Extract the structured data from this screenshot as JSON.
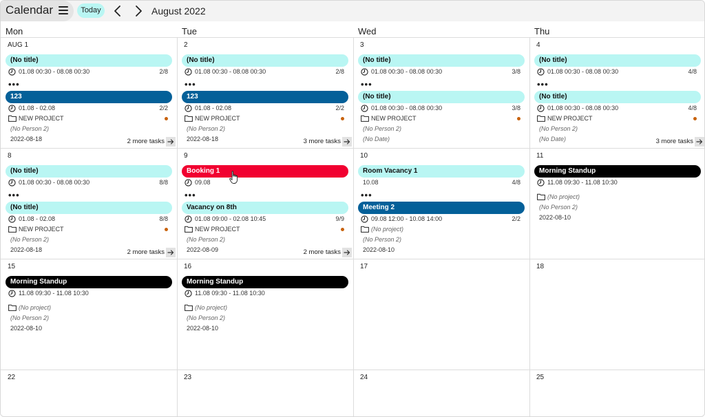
{
  "header": {
    "app_title": "Calendar",
    "today_label": "Today",
    "month_label": "August 2022",
    "menu_icon": "hamburger-menu-icon",
    "prev_icon": "chevron-left-icon",
    "next_icon": "chevron-right-icon"
  },
  "weekdays": [
    "Mon",
    "Tue",
    "Wed",
    "Thu"
  ],
  "colors": {
    "cyan": "#b9f6f3",
    "blue": "#046099",
    "red": "#f10030",
    "black": "#000000",
    "dot": "#c8620c"
  },
  "weeks": [
    {
      "days": [
        {
          "label": "AUG 1",
          "more": "2 more tasks",
          "events": [
            {
              "title": "(No title)",
              "color": "cyan",
              "time": "01.08 00:30 - 08.08 00:30",
              "ratio": "2/8"
            },
            {
              "ellipsis": "•••"
            },
            {
              "title": "123",
              "color": "blue",
              "time": "01.08 - 02.08",
              "ratio": "2/2",
              "project": "NEW PROJECT",
              "dot": true,
              "person": "(No Person 2)",
              "date": "2022-08-18"
            }
          ]
        },
        {
          "label": "2",
          "more": "3 more tasks",
          "events": [
            {
              "title": "(No title)",
              "color": "cyan",
              "time": "01.08 00:30 - 08.08 00:30",
              "ratio": "2/8"
            },
            {
              "ellipsis": "•••"
            },
            {
              "title": "123",
              "color": "blue",
              "time": "01.08 - 02.08",
              "ratio": "2/2",
              "project": "NEW PROJECT",
              "dot": true,
              "person": "(No Person 2)",
              "date": "2022-08-18"
            }
          ]
        },
        {
          "label": "3",
          "events": [
            {
              "title": "(No title)",
              "color": "cyan",
              "time": "01.08 00:30 - 08.08 00:30",
              "ratio": "3/8"
            },
            {
              "ellipsis": "•••"
            },
            {
              "title": "(No title)",
              "color": "cyan",
              "time": "01.08 00:30 - 08.08 00:30",
              "ratio": "3/8",
              "project": "NEW PROJECT",
              "dot": true,
              "person": "(No Person 2)",
              "date": "(No Date)",
              "dateItalic": true
            }
          ]
        },
        {
          "label": "4",
          "more": "3 more tasks",
          "events": [
            {
              "title": "(No title)",
              "color": "cyan",
              "time": "01.08 00:30 - 08.08 00:30",
              "ratio": "4/8"
            },
            {
              "ellipsis": "•••"
            },
            {
              "title": "(No title)",
              "color": "cyan",
              "time": "01.08 00:30 - 08.08 00:30",
              "ratio": "4/8",
              "project": "NEW PROJECT",
              "dot": true,
              "person": "(No Person 2)",
              "date": "(No Date)",
              "dateItalic": true
            }
          ]
        }
      ]
    },
    {
      "days": [
        {
          "label": "8",
          "more": "2 more tasks",
          "events": [
            {
              "title": "(No title)",
              "color": "cyan",
              "time": "01.08 00:30 - 08.08 00:30",
              "ratio": "8/8"
            },
            {
              "ellipsis": "•••"
            },
            {
              "title": "(No title)",
              "color": "cyan",
              "time": "01.08 - 02.08",
              "ratio": "8/8",
              "project": "NEW PROJECT",
              "dot": true,
              "person": "(No Person 2)",
              "date": "2022-08-18"
            }
          ]
        },
        {
          "label": "9",
          "more": "2 more tasks",
          "events": [
            {
              "title": "Booking 1",
              "color": "red",
              "time": "09.08"
            },
            {
              "ellipsis": "•••"
            },
            {
              "title": "Vacancy on 8th",
              "color": "cyan",
              "time": "01.08 09:00 - 02.08 10:45",
              "ratio": "9/9",
              "project": "NEW PROJECT",
              "dot": true,
              "person": "(No Person 2)",
              "date": "2022-08-09"
            }
          ]
        },
        {
          "label": "10",
          "events": [
            {
              "title": "Room Vacancy 1",
              "color": "cyan",
              "plain": "10.08",
              "ratio": "4/8"
            },
            {
              "ellipsis": "•••"
            },
            {
              "title": "Meeting 2",
              "color": "blue",
              "time": "09.08 12:00 - 10.08 14:00",
              "ratio": "2/2",
              "project": "(No project)",
              "projectItalic": true,
              "person": "(No Person 2)",
              "date": "2022-08-10"
            }
          ]
        },
        {
          "label": "11",
          "events": [
            {
              "title": "Morning Standup",
              "color": "black",
              "time": "11.08 09:30 - 11.08 10:30",
              "gap": true,
              "project": "(No project)",
              "projectItalic": true,
              "person": "(No Person 2)",
              "date": "2022-08-10"
            }
          ]
        }
      ]
    },
    {
      "days": [
        {
          "label": "15",
          "events": [
            {
              "title": "Morning Standup",
              "color": "black",
              "time": "11.08 09:30 - 11.08 10:30",
              "gap": true,
              "project": "(No project)",
              "projectItalic": true,
              "person": "(No Person 2)",
              "date": "2022-08-10"
            }
          ]
        },
        {
          "label": "16",
          "events": [
            {
              "title": "Morning Standup",
              "color": "black",
              "time": "11.08 09:30 - 11.08 10:30",
              "gap": true,
              "project": "(No project)",
              "projectItalic": true,
              "person": "(No Person 2)",
              "date": "2022-08-10"
            }
          ]
        },
        {
          "label": "17",
          "events": []
        },
        {
          "label": "18",
          "events": []
        }
      ]
    },
    {
      "days": [
        {
          "label": "22",
          "events": []
        },
        {
          "label": "23",
          "events": []
        },
        {
          "label": "24",
          "events": []
        },
        {
          "label": "25",
          "events": []
        }
      ]
    }
  ]
}
